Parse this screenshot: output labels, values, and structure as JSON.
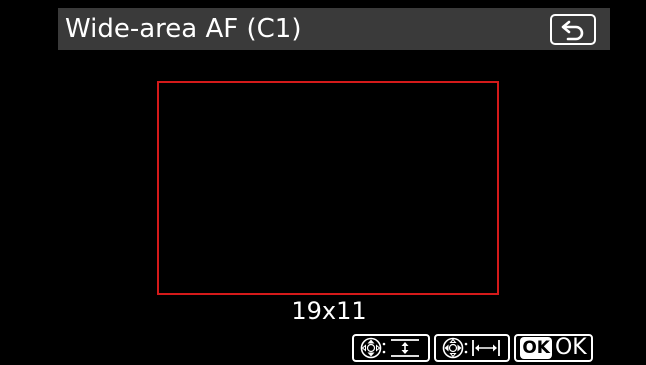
{
  "header": {
    "title": "Wide-area AF (C1)",
    "back_icon": "return-arrow-icon"
  },
  "af_area": {
    "size_label": "19x11",
    "frame_color": "#d41a1a"
  },
  "hints": {
    "height": {
      "icon": "multi-selector-up-down-icon",
      "symbol": "height-adjust-icon"
    },
    "width": {
      "icon": "multi-selector-left-right-icon",
      "symbol": "width-adjust-icon"
    },
    "ok": {
      "badge": "OK",
      "label": "OK"
    }
  },
  "colors": {
    "background": "#000000",
    "title_bar": "#3a3a3a",
    "text": "#ffffff",
    "af_frame": "#d41a1a"
  }
}
